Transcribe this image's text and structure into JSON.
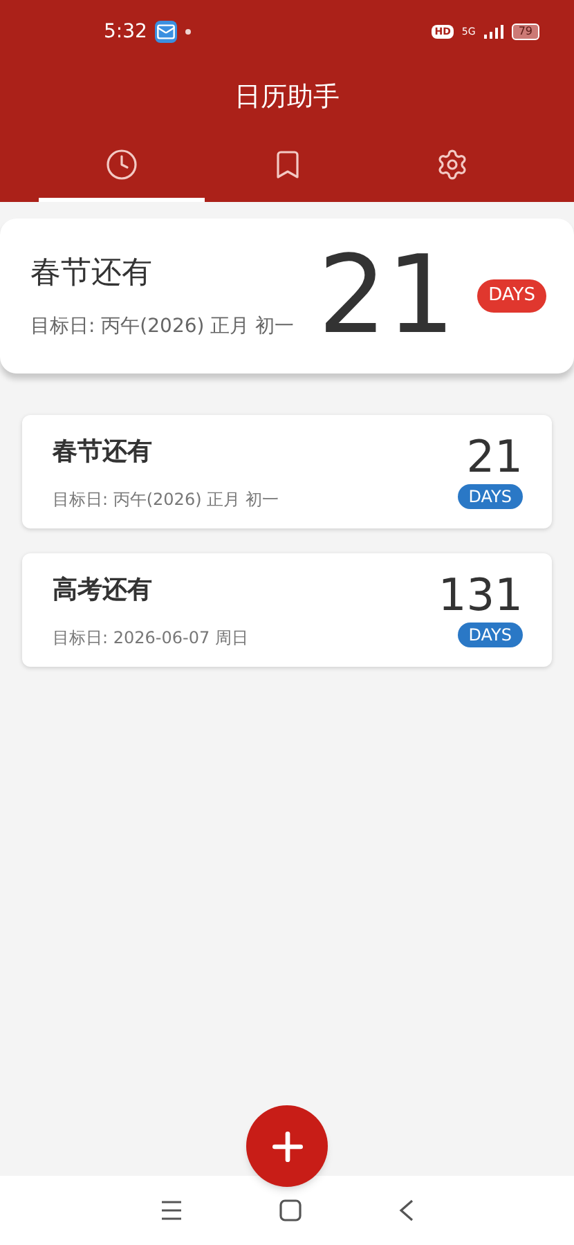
{
  "status_bar": {
    "time": "5:32",
    "hd": "HD",
    "network": "5G",
    "battery": "79"
  },
  "app_bar": {
    "title": "日历助手"
  },
  "tabs": [
    {
      "kind": "clock",
      "selected": true
    },
    {
      "kind": "bookmark",
      "selected": false
    },
    {
      "kind": "settings",
      "selected": false
    }
  ],
  "hero": {
    "title": "春节还有",
    "target": "目标日: 丙午(2026) 正月 初一",
    "count": "21",
    "unit": "DAYS"
  },
  "events": [
    {
      "title": "春节还有",
      "target": "目标日: 丙午(2026) 正月 初一",
      "count": "21",
      "unit": "DAYS"
    },
    {
      "title": "高考还有",
      "target": "目标日: 2026-06-07 周日",
      "count": "131",
      "unit": "DAYS"
    }
  ]
}
